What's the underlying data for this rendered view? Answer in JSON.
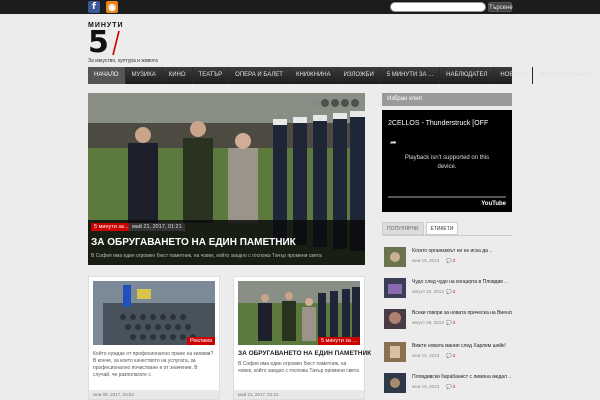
{
  "header": {
    "search_placeholder": "",
    "search_button": "Търсене",
    "logo_top": "МИНУТИ",
    "logo_number": "5",
    "logo_tagline": "За изкуство, култура и живота"
  },
  "nav": {
    "items": [
      "Начало",
      "Музика",
      "Кино",
      "Театър",
      "Опера и балет",
      "Книжнина",
      "Изложби",
      "5 минути за ...",
      "Наблюдател",
      "Новини",
      "Изпрати новина"
    ]
  },
  "slider": {
    "category": "5 минути за ...",
    "date": "май 21, 2017, 01:21",
    "title": "За обругаването на един паметник",
    "excerpt": "В София има един огромен бюст паметник, на човек, който заедно с госпожа Тачър промени света"
  },
  "cards": [
    {
      "badge": "Реклама",
      "title": "",
      "text": "Който нуждае от професионално пране на килими? В конче, за което качеството на услугата, за професионално почистване е от значение. В случай, че разполагате с",
      "date": "юни 08, 2017, 03:52"
    },
    {
      "badge": "5 минути за ...",
      "title": "За обругаването на един паметник",
      "text": "В София има един огромен бюст паметник, на човек, който заедно с госпожа Тачър промени света",
      "date": "май 21, 2017, 01:21"
    }
  ],
  "sidebar": {
    "heading": "Избран клип",
    "video": {
      "title": "2CELLOS - Thunderstruck [OFF",
      "message_line1": "Playback isn't supported on this",
      "message_line2": "device.",
      "logo": "YouTube"
    },
    "tabs": [
      "Популярни",
      "Етикети"
    ],
    "items": [
      {
        "title": "Когато организмът ни не иска да ..",
        "date": "юни 15, 2013",
        "comments": "2"
      },
      {
        "title": "Чудо след чудо на концерта в Пловдив ..",
        "date": "август 22, 2013",
        "comments": "2"
      },
      {
        "title": "Всеки говори за новата прическа на Виенска ..",
        "date": "август 09, 2013",
        "comments": "2"
      },
      {
        "title": "Вижте новата мания след Харлем шейк!",
        "date": "юни 14, 2013",
        "comments": "2"
      },
      {
        "title": "Пловдивски барабанист с лимона медал ..",
        "date": "юни 19, 2013",
        "comments": "2"
      }
    ]
  },
  "colors": {
    "accent": "#cc0000",
    "nav_bg": "#2a2a2a",
    "top_bar": "#1c1c1c"
  }
}
